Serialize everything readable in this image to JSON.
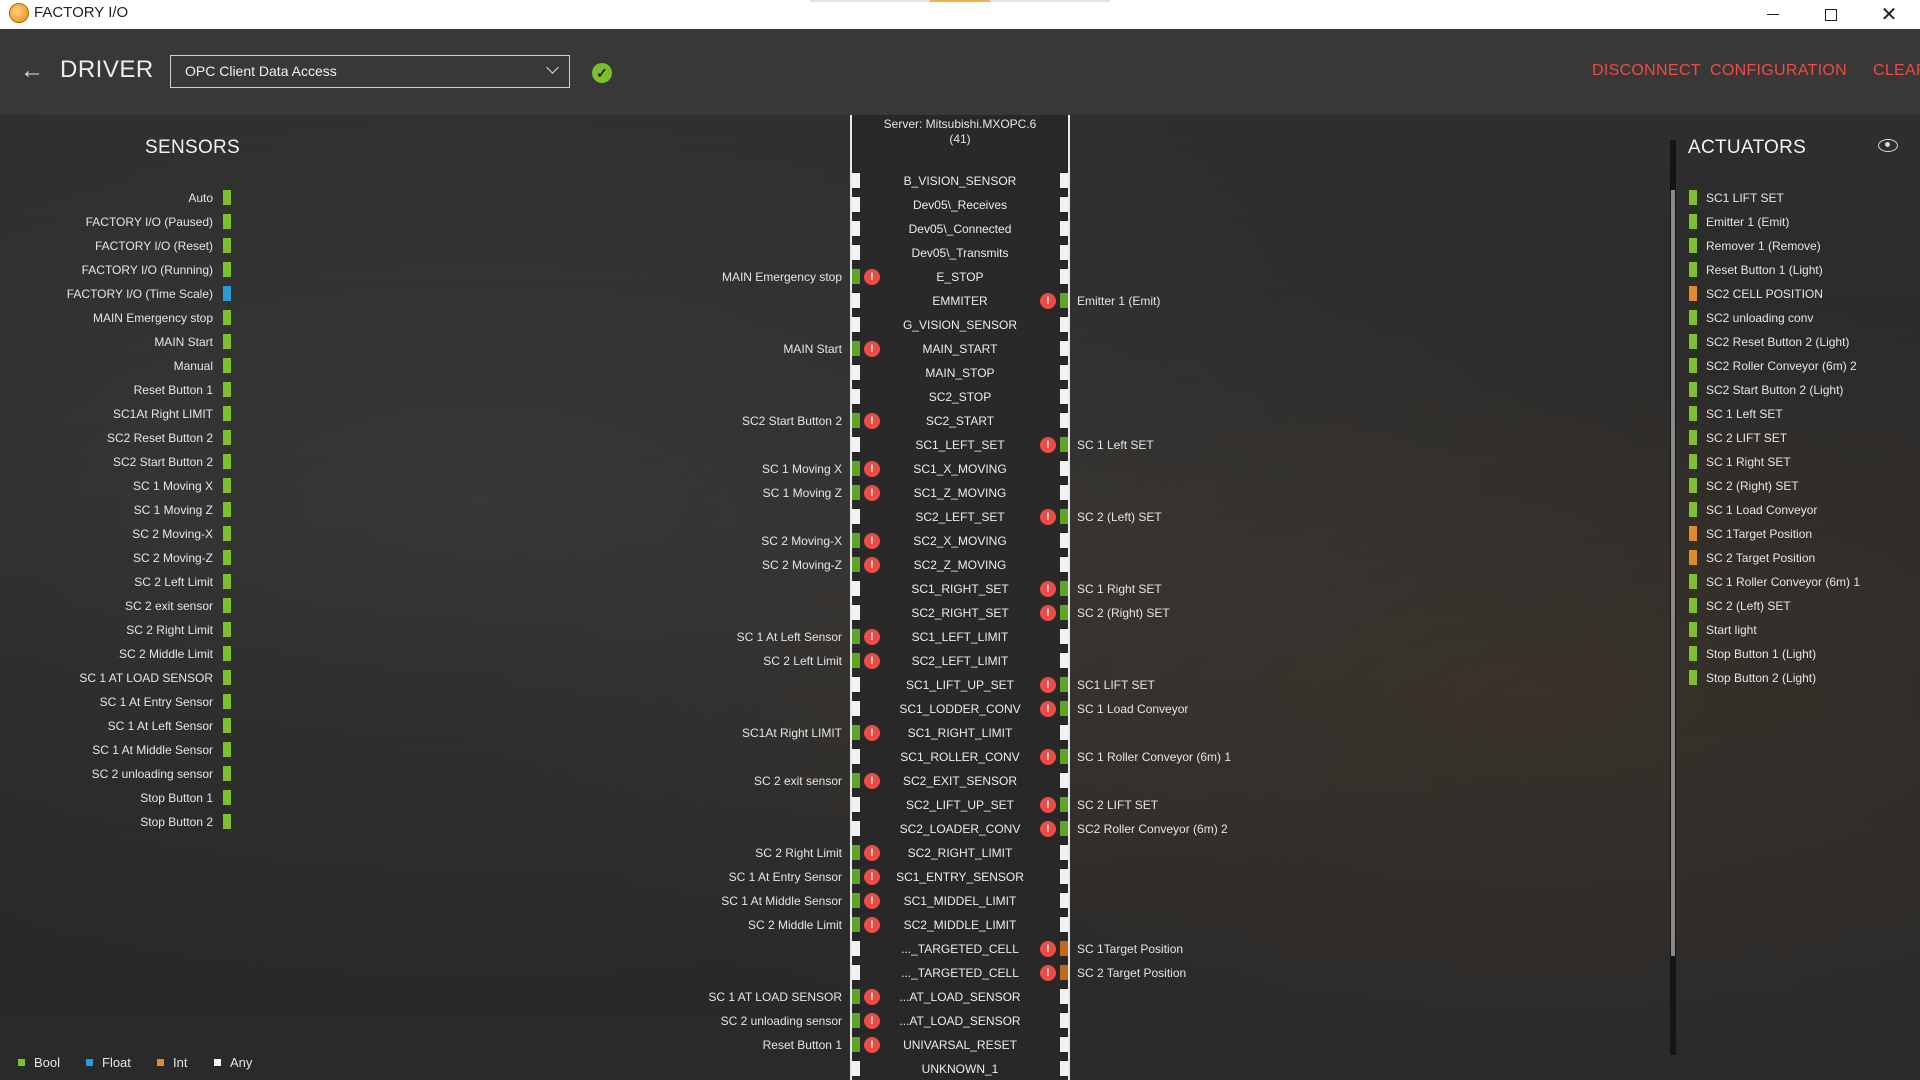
{
  "app": {
    "title": "FACTORY I/O"
  },
  "header": {
    "title": "DRIVER",
    "driver": "OPC Client Data Access",
    "actions": {
      "disconnect": "DISCONNECT",
      "configuration": "CONFIGURATION",
      "clear": "CLEAR"
    }
  },
  "colors": {
    "bool": "#7dbf2f",
    "float": "#2b9bd6",
    "int": "#e08a2a",
    "any": "#f2f2f2",
    "accent_red": "#f04a43"
  },
  "sensors": {
    "title": "SENSORS",
    "items": [
      {
        "label": "Auto",
        "type": "bool"
      },
      {
        "label": "FACTORY I/O (Paused)",
        "type": "bool"
      },
      {
        "label": "FACTORY I/O (Reset)",
        "type": "bool"
      },
      {
        "label": "FACTORY I/O (Running)",
        "type": "bool"
      },
      {
        "label": "FACTORY I/O (Time Scale)",
        "type": "float"
      },
      {
        "label": "MAIN Emergency stop",
        "type": "bool"
      },
      {
        "label": "MAIN Start",
        "type": "bool"
      },
      {
        "label": "Manual",
        "type": "bool"
      },
      {
        "label": "Reset Button 1",
        "type": "bool"
      },
      {
        "label": "SC1At Right LIMIT",
        "type": "bool"
      },
      {
        "label": "SC2 Reset Button 2",
        "type": "bool"
      },
      {
        "label": "SC2 Start Button 2",
        "type": "bool"
      },
      {
        "label": "SC 1 Moving X",
        "type": "bool"
      },
      {
        "label": "SC 1 Moving Z",
        "type": "bool"
      },
      {
        "label": "SC 2 Moving-X",
        "type": "bool"
      },
      {
        "label": "SC 2 Moving-Z",
        "type": "bool"
      },
      {
        "label": "SC 2 Left Limit",
        "type": "bool"
      },
      {
        "label": "SC 2 exit sensor",
        "type": "bool"
      },
      {
        "label": "SC 2 Right Limit",
        "type": "bool"
      },
      {
        "label": "SC 2 Middle Limit",
        "type": "bool"
      },
      {
        "label": "SC 1 AT LOAD SENSOR",
        "type": "bool"
      },
      {
        "label": "SC 1 At Entry Sensor",
        "type": "bool"
      },
      {
        "label": "SC 1 At  Left  Sensor",
        "type": "bool"
      },
      {
        "label": "SC 1 At Middle Sensor",
        "type": "bool"
      },
      {
        "label": "SC 2 unloading sensor",
        "type": "bool"
      },
      {
        "label": "Stop Button 1",
        "type": "bool"
      },
      {
        "label": "Stop Button 2",
        "type": "bool"
      }
    ]
  },
  "actuators": {
    "title": "ACTUATORS",
    "items": [
      {
        "label": "SC1 LIFT SET",
        "type": "bool"
      },
      {
        "label": "Emitter 1 (Emit)",
        "type": "bool"
      },
      {
        "label": "Remover 1 (Remove)",
        "type": "bool"
      },
      {
        "label": "Reset Button 1 (Light)",
        "type": "bool"
      },
      {
        "label": "SC2 CELL POSITION",
        "type": "int"
      },
      {
        "label": "SC2 unloading  conv",
        "type": "bool"
      },
      {
        "label": "SC2 Reset Button 2 (Light)",
        "type": "bool"
      },
      {
        "label": "SC2 Roller Conveyor (6m) 2",
        "type": "bool"
      },
      {
        "label": "SC2 Start Button 2 (Light)",
        "type": "bool"
      },
      {
        "label": "SC 1 Left SET",
        "type": "bool"
      },
      {
        "label": "SC 2 LIFT SET",
        "type": "bool"
      },
      {
        "label": "SC 1 Right SET",
        "type": "bool"
      },
      {
        "label": "SC 2 (Right) SET",
        "type": "bool"
      },
      {
        "label": "SC 1 Load Conveyor",
        "type": "bool"
      },
      {
        "label": "SC 1Target Position",
        "type": "int"
      },
      {
        "label": "SC 2 Target Position",
        "type": "int"
      },
      {
        "label": "SC 1 Roller Conveyor (6m) 1",
        "type": "bool"
      },
      {
        "label": "SC  2 (Left) SET",
        "type": "bool"
      },
      {
        "label": "Start light",
        "type": "bool"
      },
      {
        "label": "Stop Button 1 (Light)",
        "type": "bool"
      },
      {
        "label": "Stop Button 2 (Light)",
        "type": "bool"
      }
    ]
  },
  "server": {
    "label": "Server: Mitsubishi.MXOPC.6",
    "count": "(41)",
    "tags": [
      {
        "name": "B_VISION_SENSOR",
        "in": "",
        "out": ""
      },
      {
        "name": "Dev05\\_Receives",
        "in": "",
        "out": ""
      },
      {
        "name": "Dev05\\_Connected",
        "in": "",
        "out": ""
      },
      {
        "name": "Dev05\\_Transmits",
        "in": "",
        "out": ""
      },
      {
        "name": "E_STOP",
        "in": "MAIN Emergency stop",
        "out": ""
      },
      {
        "name": "EMMITER",
        "in": "",
        "out": "Emitter 1 (Emit)"
      },
      {
        "name": "G_VISION_SENSOR",
        "in": "",
        "out": ""
      },
      {
        "name": "MAIN_START",
        "in": "MAIN Start",
        "out": ""
      },
      {
        "name": "MAIN_STOP",
        "in": "",
        "out": ""
      },
      {
        "name": "SC2_STOP",
        "in": "",
        "out": ""
      },
      {
        "name": "SC2_START",
        "in": "SC2 Start Button 2",
        "out": ""
      },
      {
        "name": "SC1_LEFT_SET",
        "in": "",
        "out": "SC 1 Left SET"
      },
      {
        "name": "SC1_X_MOVING",
        "in": "SC 1 Moving X",
        "out": ""
      },
      {
        "name": "SC1_Z_MOVING",
        "in": "SC 1 Moving Z",
        "out": ""
      },
      {
        "name": "SC2_LEFT_SET",
        "in": "",
        "out": "SC  2 (Left) SET"
      },
      {
        "name": "SC2_X_MOVING",
        "in": "SC 2 Moving-X",
        "out": ""
      },
      {
        "name": "SC2_Z_MOVING",
        "in": "SC 2 Moving-Z",
        "out": ""
      },
      {
        "name": "SC1_RIGHT_SET",
        "in": "",
        "out": "SC 1 Right SET"
      },
      {
        "name": "SC2_RIGHT_SET",
        "in": "",
        "out": "SC 2 (Right) SET"
      },
      {
        "name": "SC1_LEFT_LIMIT",
        "in": "SC 1 At  Left  Sensor",
        "out": ""
      },
      {
        "name": "SC2_LEFT_LIMIT",
        "in": "SC 2 Left Limit",
        "out": ""
      },
      {
        "name": "SC1_LIFT_UP_SET",
        "in": "",
        "out": "SC1 LIFT SET"
      },
      {
        "name": "SC1_LODDER_CONV",
        "in": "",
        "out": "SC 1 Load Conveyor"
      },
      {
        "name": "SC1_RIGHT_LIMIT",
        "in": "SC1At Right LIMIT",
        "out": ""
      },
      {
        "name": "SC1_ROLLER_CONV",
        "in": "",
        "out": "SC 1 Roller Conveyor (6m) 1"
      },
      {
        "name": "SC2_EXIT_SENSOR",
        "in": "SC 2 exit sensor",
        "out": ""
      },
      {
        "name": "SC2_LIFT_UP_SET",
        "in": "",
        "out": "SC 2 LIFT SET"
      },
      {
        "name": "SC2_LOADER_CONV",
        "in": "",
        "out": "SC2 Roller Conveyor (6m) 2"
      },
      {
        "name": "SC2_RIGHT_LIMIT",
        "in": "SC 2 Right Limit",
        "out": ""
      },
      {
        "name": "SC1_ENTRY_SENSOR",
        "in": "SC 1 At Entry Sensor",
        "out": ""
      },
      {
        "name": "SC1_MIDDEL_LIMIT",
        "in": "SC 1 At Middle Sensor",
        "out": ""
      },
      {
        "name": "SC2_MIDDLE_LIMIT",
        "in": "SC 2 Middle Limit",
        "out": ""
      },
      {
        "name": "..._TARGETED_CELL",
        "in": "",
        "out": "SC 1Target Position"
      },
      {
        "name": "..._TARGETED_CELL",
        "in": "",
        "out": "SC 2 Target Position"
      },
      {
        "name": "...AT_LOAD_SENSOR",
        "in": "SC 1 AT LOAD SENSOR",
        "out": ""
      },
      {
        "name": "...AT_LOAD_SENSOR",
        "in": "SC 2 unloading sensor",
        "out": ""
      },
      {
        "name": "UNIVARSAL_RESET",
        "in": "Reset Button 1",
        "out": ""
      },
      {
        "name": "UNKNOWN_1",
        "in": "",
        "out": ""
      }
    ]
  },
  "legend": [
    {
      "label": "Bool",
      "type": "bool"
    },
    {
      "label": "Float",
      "type": "float"
    },
    {
      "label": "Int",
      "type": "int"
    },
    {
      "label": "Any",
      "type": "any"
    }
  ]
}
